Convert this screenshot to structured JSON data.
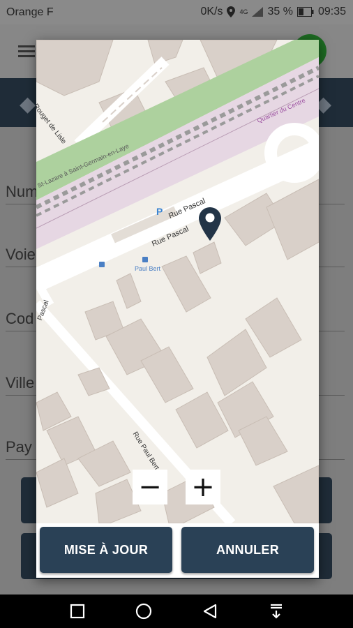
{
  "status_bar": {
    "carrier": "Orange F",
    "speed": "0K/s",
    "network": "4G",
    "battery": "35 %",
    "time": "09:35"
  },
  "form": {
    "fields": [
      {
        "label": "Num"
      },
      {
        "label": "Voie"
      },
      {
        "label": "Cod"
      },
      {
        "label": "Ville"
      },
      {
        "label": "Pay"
      }
    ]
  },
  "map": {
    "labels": {
      "rail_line": "St-Lazare à Saint-Germain-en-Laye",
      "street_rouget": "Rouget de Lisle",
      "district": "Quartier du Centre",
      "street_pascal_1": "Rue Pascal",
      "street_pascal_2": "Rue Pascal",
      "street_left": "Pascal",
      "bus_stop": "Paul Bert",
      "street_paul_bert": "Rue Paul Bert",
      "parking": "P"
    },
    "zoom_out": "−",
    "zoom_in": "+"
  },
  "dialog": {
    "confirm_label": "MISE À JOUR",
    "cancel_label": "ANNULER"
  },
  "colors": {
    "primary": "#2a4156",
    "dark_band": "#1f2c38",
    "marker": "#223447",
    "map_background": "#f2efe9",
    "buildings": "#d9d0c9",
    "park": "#add19e",
    "rail_area": "#e6d7e3"
  }
}
